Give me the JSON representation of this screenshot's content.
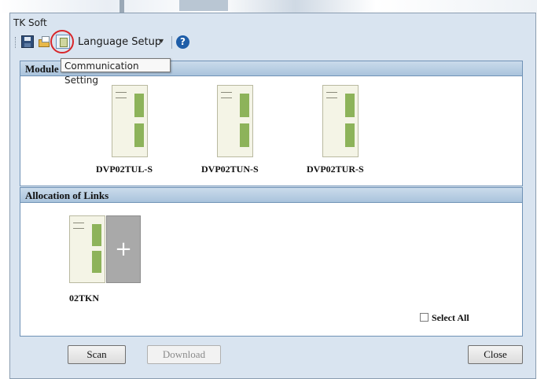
{
  "window": {
    "title": "TK Soft"
  },
  "toolbar": {
    "icons": [
      "save-icon",
      "open-folder-icon",
      "communication-setting-icon",
      "help-icon"
    ],
    "language_label": "Language Setup",
    "help_glyph": "?"
  },
  "tooltip": {
    "text": "Communication Setting"
  },
  "module_group": {
    "title": "Module Name",
    "modules": [
      {
        "label": "DVP02TUL-S"
      },
      {
        "label": "DVP02TUN-S"
      },
      {
        "label": "DVP02TUR-S"
      }
    ]
  },
  "links_group": {
    "title": "Allocation of Links",
    "linked_module": "02TKN",
    "add_glyph": "+",
    "select_all_label": "Select All"
  },
  "buttons": {
    "scan": "Scan",
    "download": "Download",
    "close": "Close"
  },
  "colors": {
    "accent": "#6f92b6",
    "highlight_circle": "#d8262a",
    "module_stripe": "#8db35a"
  }
}
